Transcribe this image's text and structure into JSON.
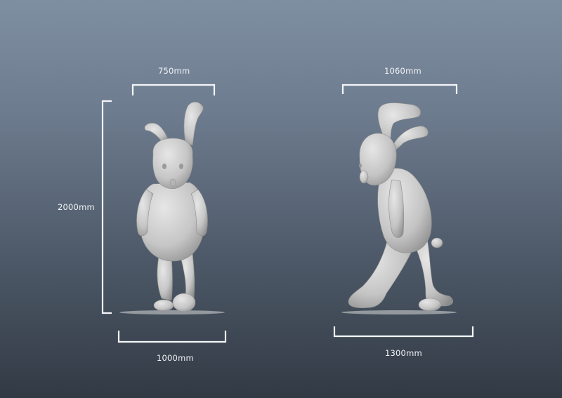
{
  "front_view": {
    "width_top_label": "750mm",
    "height_label": "2000mm",
    "base_width_label": "1000mm"
  },
  "side_view": {
    "width_top_label": "1060mm",
    "base_width_label": "1300mm"
  },
  "colors": {
    "dimension_line": "#f4f6f8",
    "model": "#cdcdcd"
  }
}
